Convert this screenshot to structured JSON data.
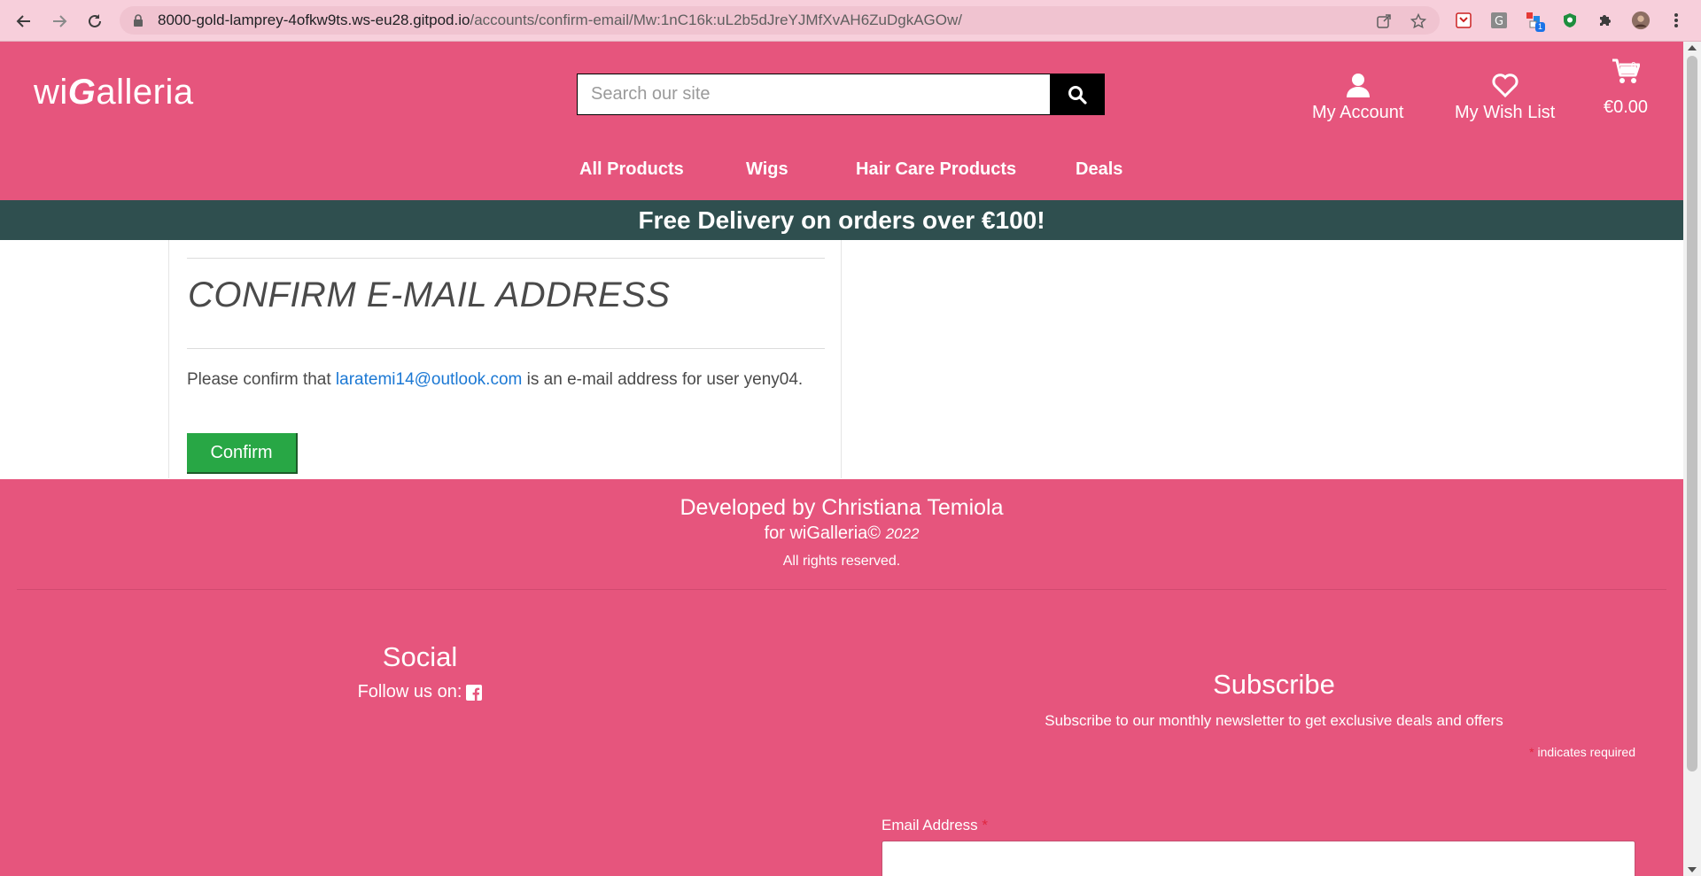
{
  "browser": {
    "url_host": "8000-gold-lamprey-4ofkw9ts.ws-eu28.gitpod.io",
    "url_path": "/accounts/confirm-email/Mw:1nC16k:uL2b5dJreYJMfXvAH6ZuDgkAGOw/",
    "extension_badge": "1"
  },
  "header": {
    "logo_prefix": "wi",
    "logo_g": "G",
    "logo_suffix": "alleria",
    "search_placeholder": "Search our site",
    "account_label": "My Account",
    "wishlist_label": "My Wish List",
    "cart_total": "€0.00",
    "cart_count": "0"
  },
  "nav": {
    "items": [
      {
        "label": "All Products"
      },
      {
        "label": "Wigs"
      },
      {
        "label": "Hair Care Products"
      },
      {
        "label": "Deals"
      }
    ]
  },
  "banner": {
    "text": "Free Delivery on orders over €100!"
  },
  "confirm": {
    "title": "CONFIRM E-MAIL ADDRESS",
    "text_before": "Please confirm that ",
    "email": "laratemi14@outlook.com",
    "text_after": " is an e-mail address for user yeny04.",
    "button_label": "Confirm"
  },
  "footer": {
    "developed_by": "Developed by Christiana Temiola",
    "for_text": "for wiGalleria©",
    "year": "2022",
    "rights": "All rights reserved.",
    "social_title": "Social",
    "follow_text": "Follow us on:",
    "subscribe_title": "Subscribe",
    "subscribe_text": "Subscribe to our monthly newsletter to get exclusive deals and offers",
    "required_mark": "*",
    "required_text": "indicates required",
    "email_label": "Email Address",
    "email_value": ""
  },
  "colors": {
    "brand_pink": "#e6557d",
    "banner_dark": "#2f4f4f",
    "confirm_green": "#28a745",
    "link_blue": "#1b78d4"
  }
}
